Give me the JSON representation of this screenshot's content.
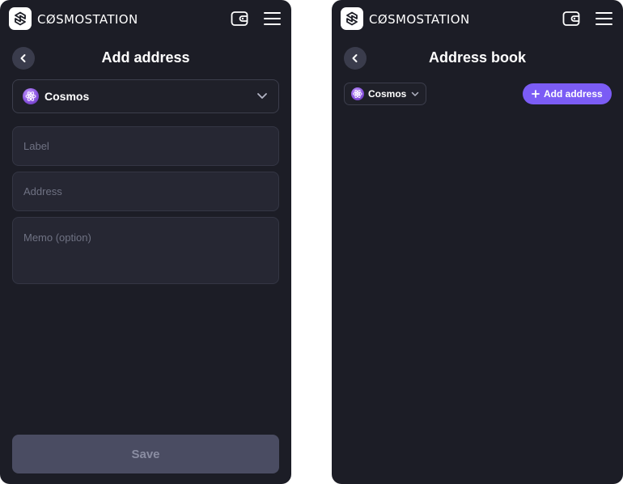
{
  "brand": "CØSMOSTATION",
  "icons": {
    "logo": "cosmostation-logo-icon",
    "wallet": "wallet-icon",
    "menu": "hamburger-menu-icon",
    "back": "chevron-left-icon",
    "chain": "cosmos-atom-icon",
    "dropdown": "chevron-down-icon",
    "add": "plus-icon"
  },
  "colors": {
    "panel_bg": "#1c1d26",
    "field_bg": "#262733",
    "accent": "#7b5cf5",
    "save_disabled_bg": "#4a4c62"
  },
  "add_address_screen": {
    "title": "Add address",
    "chain_select": {
      "selected": "Cosmos"
    },
    "form": {
      "label_placeholder": "Label",
      "address_placeholder": "Address",
      "memo_placeholder": "Memo (option)"
    },
    "save_label": "Save"
  },
  "address_book_screen": {
    "title": "Address book",
    "chain_filter": {
      "selected": "Cosmos"
    },
    "add_button_label": "Add address"
  }
}
